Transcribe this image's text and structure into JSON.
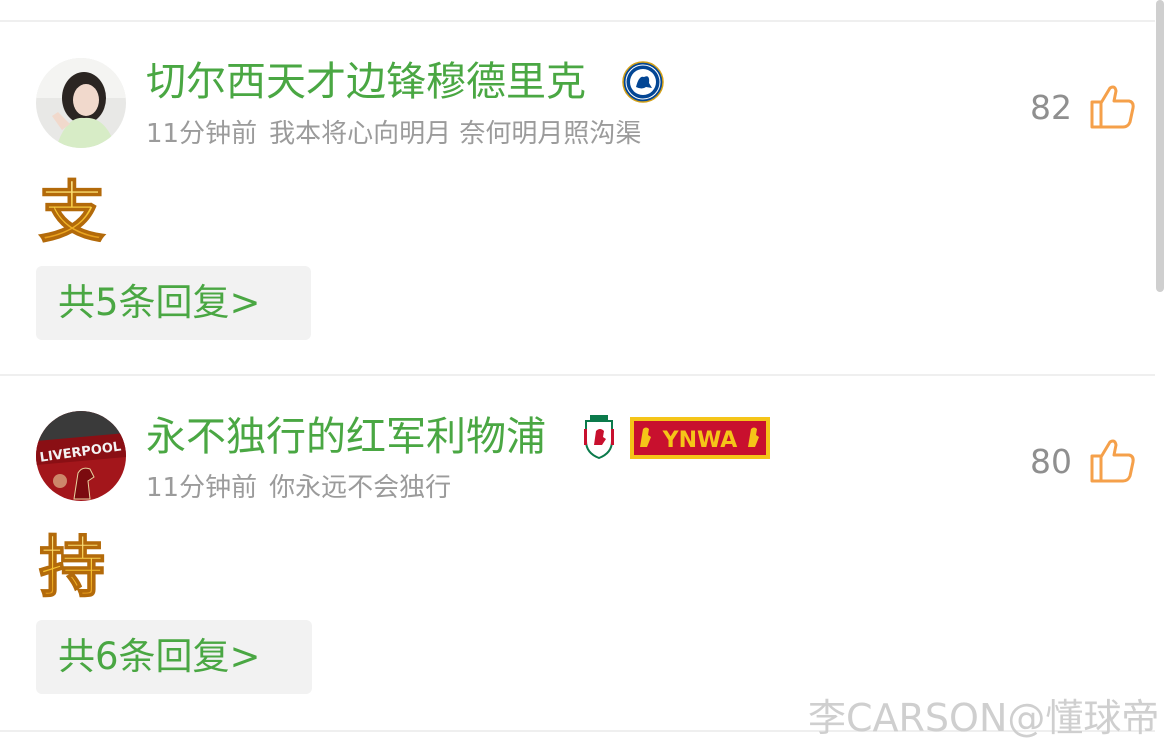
{
  "comments": [
    {
      "username": "切尔西天才边锋穆德里克",
      "time": "11分钟前",
      "signature": "我本将心向明月 奈何明月照沟渠",
      "likes": "82",
      "content": "支",
      "replies_label": "共5条回复>",
      "badge_icon": "chelsea-crest-icon",
      "avatar_icon": "girl-avatar"
    },
    {
      "username": "永不独行的红军利物浦",
      "time": "11分钟前",
      "signature": "你永远不会独行",
      "likes": "80",
      "content": "持",
      "replies_label": "共6条回复>",
      "badge_icon": "liverpool-crest-icon",
      "scarf_text": "YNWA",
      "avatar_icon": "liverpool-avatar"
    }
  ],
  "watermark": "李CARSON@懂球帝",
  "colors": {
    "username": "#4aa743",
    "like_icon": "#f5a04a",
    "meta": "#9b9b9b"
  }
}
